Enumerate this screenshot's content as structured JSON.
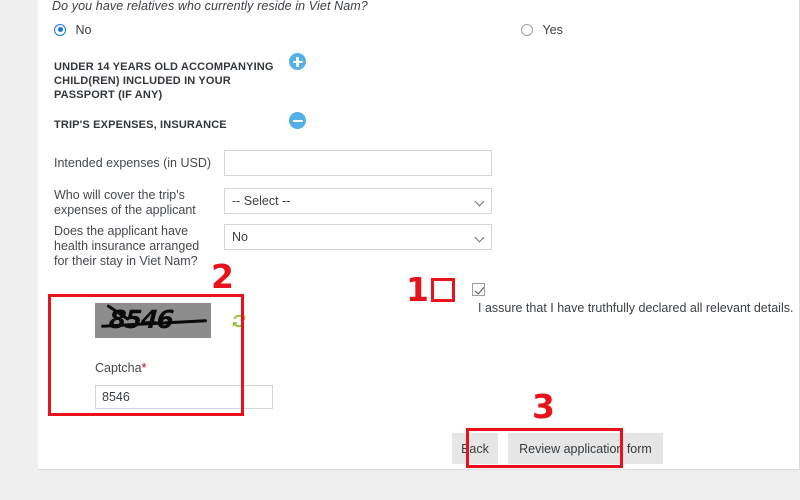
{
  "form": {
    "relatives_question": "Do you have relatives who currently reside in Viet Nam?",
    "relatives_options": [
      {
        "label": "No",
        "checked": true
      },
      {
        "label": "Yes",
        "checked": false
      }
    ],
    "sections": [
      {
        "title": "UNDER 14 YEARS OLD ACCOMPANYING CHILD(REN) INCLUDED IN YOUR PASSPORT (IF ANY)",
        "toggle_icon": "plus-circle-icon",
        "expanded": false
      },
      {
        "title": "TRIP'S EXPENSES, INSURANCE",
        "toggle_icon": "minus-circle-icon",
        "expanded": true
      }
    ],
    "fields": {
      "intended_expenses": {
        "label": "Intended expenses (in USD)",
        "value": "",
        "placeholder": ""
      },
      "who_covers": {
        "label": "Who will cover the trip's expenses of the applicant",
        "value": "-- Select --"
      },
      "health_insurance": {
        "label": "Does the applicant have health insurance arranged for their stay in Viet Nam?",
        "value": "No"
      }
    },
    "declaration": {
      "checked": true,
      "text": "I assure that I have truthfully declared all relevant details."
    },
    "captcha": {
      "image_text": "8546",
      "refresh_icon": "refresh-icon",
      "label": "Captcha",
      "required_marker": "*",
      "value": "8546",
      "placeholder": ""
    },
    "buttons": {
      "back": "Back",
      "review": "Review application form"
    }
  },
  "annotations": {
    "color": "#e8131a",
    "markers": [
      {
        "number": "1",
        "target": "declaration-checkbox"
      },
      {
        "number": "2",
        "target": "captcha-block"
      },
      {
        "number": "3",
        "target": "review-application-form-button"
      }
    ]
  },
  "theme": {
    "accent_blue": "#55b0e8",
    "radio_blue": "#1a73e8",
    "refresh_green": "#8cc63f",
    "annotation_red": "#e8131a",
    "button_gray": "#e6e6e6",
    "captcha_gray": "#8d8d8d"
  }
}
